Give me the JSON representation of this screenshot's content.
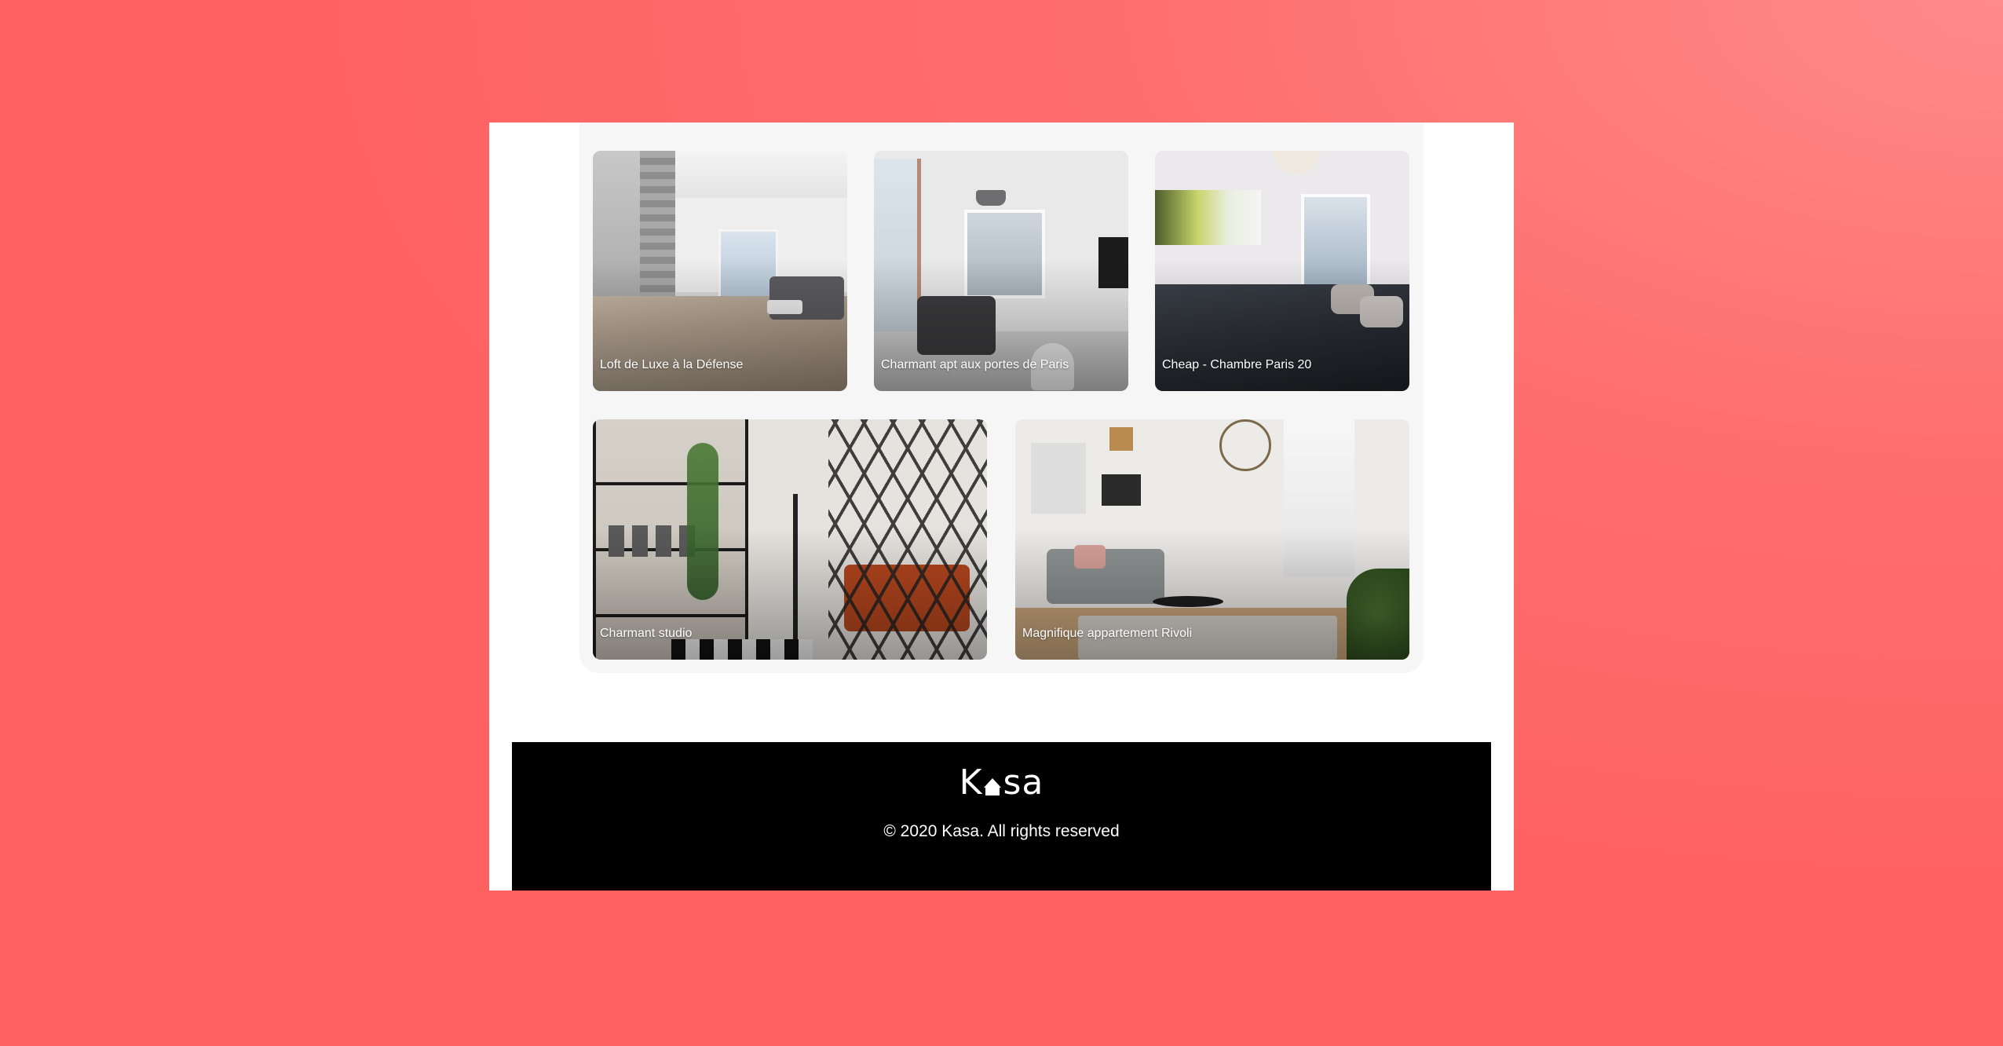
{
  "colors": {
    "background": "#ff6060",
    "page": "#ffffff",
    "gallery": "#f6f6f6",
    "footer": "#000000",
    "text_light": "#ffffff"
  },
  "gallery": {
    "cards": [
      {
        "title": "Loft de Luxe à la Défense"
      },
      {
        "title": "Charmant apt aux portes de Paris"
      },
      {
        "title": "Cheap - Chambre Paris 20"
      },
      {
        "title": "Charmant studio"
      },
      {
        "title": "Magnifique appartement Rivoli"
      }
    ]
  },
  "footer": {
    "logo_left": "K",
    "logo_right": "sa",
    "logo_icon": "house-icon",
    "copyright": "© 2020 Kasa. All rights reserved"
  }
}
